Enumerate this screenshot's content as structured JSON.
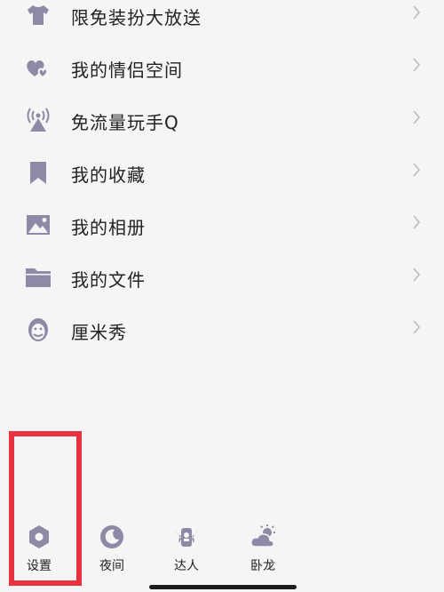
{
  "menu": {
    "items": [
      {
        "label": "限免装扮大放送",
        "icon": "tshirt-icon"
      },
      {
        "label": "我的情侣空间",
        "icon": "hearts-icon"
      },
      {
        "label": "免流量玩手Q",
        "icon": "signal-tower-icon"
      },
      {
        "label": "我的收藏",
        "icon": "bookmark-icon"
      },
      {
        "label": "我的相册",
        "icon": "photo-icon"
      },
      {
        "label": "我的文件",
        "icon": "folder-icon"
      },
      {
        "label": "厘米秀",
        "icon": "avatar-face-icon"
      }
    ]
  },
  "bottom_bar": {
    "settings_label": "设置",
    "night_label": "夜间",
    "expert_label": "达人",
    "weather_label": "卧龙"
  },
  "colors": {
    "icon": "#8e8aa6",
    "highlight": "#e8323f",
    "background": "#f6f4f5"
  }
}
